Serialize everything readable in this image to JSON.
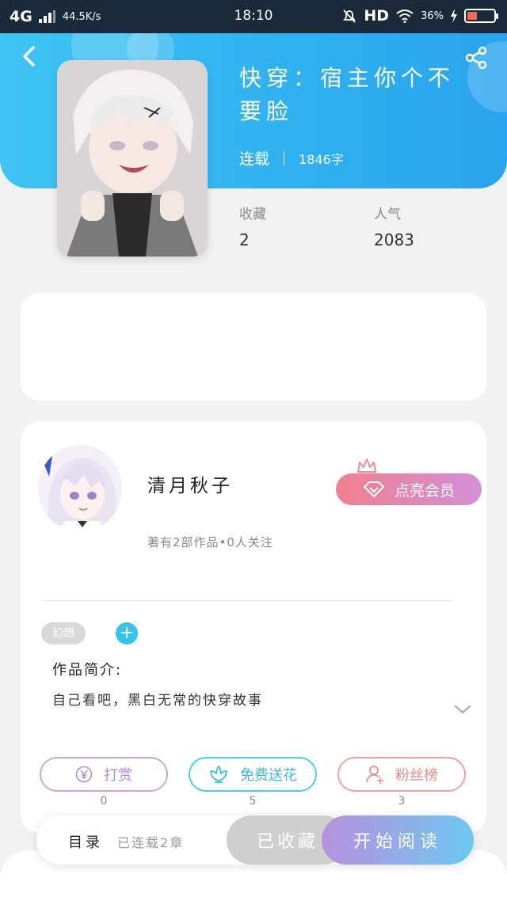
{
  "status_bar": {
    "network": "4G",
    "speed": "44.5K/s",
    "time": "18:10",
    "hd": "HD",
    "battery_text": "36%",
    "battery_level": 0.36
  },
  "book": {
    "title": "快穿：宿主你个不要脸",
    "status": "连载",
    "word_count": "1846字",
    "stats": [
      {
        "label": "收藏",
        "value": "2"
      },
      {
        "label": "人气",
        "value": "2083"
      }
    ]
  },
  "author": {
    "name": "清月秋子",
    "meta": "著有2部作品•0人关注",
    "vip_label": "点亮会员"
  },
  "tags": [
    "幻想"
  ],
  "intro": {
    "title": "作品简介:",
    "text": "自己看吧，黑白无常的快穿故事"
  },
  "actions": [
    {
      "label": "打赏",
      "count": "0",
      "icon": "yen-icon"
    },
    {
      "label": "免费送花",
      "count": "5",
      "icon": "flower-icon"
    },
    {
      "label": "粉丝榜",
      "count": "3",
      "icon": "user-icon"
    }
  ],
  "bottom_bar": {
    "catalog_label": "目录",
    "catalog_count": "已连载2章",
    "collected_label": "已收藏",
    "read_label": "开始阅读"
  },
  "colors": {
    "header_blue": "#2fb0f0",
    "accent_cyan": "#37c2ee",
    "vip_pink": "#f07f8e",
    "reward_purple": "#b58ad8",
    "fans_red": "#ea8a8a"
  }
}
